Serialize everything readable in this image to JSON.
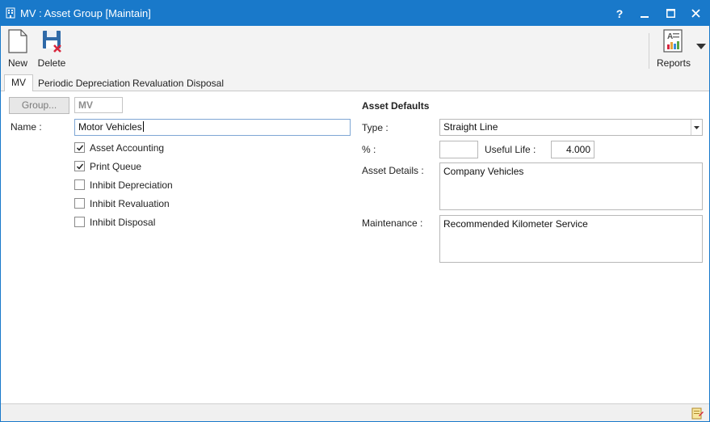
{
  "window": {
    "title": "MV : Asset Group [Maintain]",
    "controls": {
      "help": "?",
      "minimize": "minimize-icon",
      "maximize": "maximize-icon",
      "close": "close-icon"
    }
  },
  "ribbon": {
    "new_label": "New",
    "delete_label": "Delete",
    "reports_label": "Reports"
  },
  "tabs": [
    {
      "label": "MV",
      "active": true
    },
    {
      "label": "Periodic Depreciation",
      "active": false
    },
    {
      "label": "Revaluation",
      "active": false
    },
    {
      "label": "Disposal",
      "active": false
    }
  ],
  "left": {
    "group_button": "Group...",
    "group_code": "MV",
    "name_label": "Name :",
    "name_value": "Motor Vehicles",
    "checkboxes": [
      {
        "label": "Asset Accounting",
        "checked": true
      },
      {
        "label": "Print Queue",
        "checked": true
      },
      {
        "label": "Inhibit Depreciation",
        "checked": false
      },
      {
        "label": "Inhibit Revaluation",
        "checked": false
      },
      {
        "label": "Inhibit Disposal",
        "checked": false
      }
    ]
  },
  "right": {
    "section_title": "Asset Defaults",
    "type_label": "Type :",
    "type_value": "Straight Line",
    "percent_label": "% :",
    "percent_value": "",
    "useful_life_label": "Useful Life :",
    "useful_life_value": "4.000",
    "asset_details_label": "Asset Details :",
    "asset_details_value": "Company Vehicles",
    "maintenance_label": "Maintenance :",
    "maintenance_value": "Recommended Kilometer Service"
  },
  "colors": {
    "titlebar": "#1979ca",
    "ribbon": "#f3f3f3"
  }
}
